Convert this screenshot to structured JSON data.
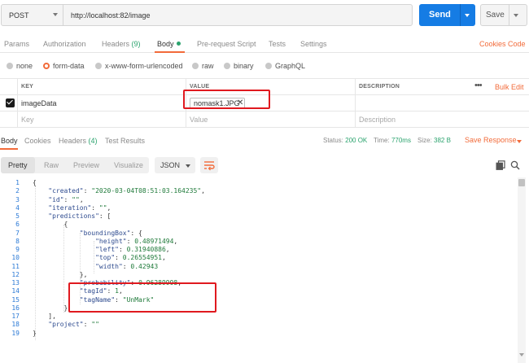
{
  "request": {
    "method": "POST",
    "url": "http://localhost:82/image",
    "send_label": "Send",
    "save_label": "Save"
  },
  "request_tabs": [
    {
      "label": "Params"
    },
    {
      "label": "Authorization"
    },
    {
      "label": "Headers",
      "count": "(9)"
    },
    {
      "label": "Body"
    },
    {
      "label": "Pre-request Script"
    },
    {
      "label": "Tests"
    },
    {
      "label": "Settings"
    }
  ],
  "request_links": {
    "cookies": "Cookies",
    "code": "Code"
  },
  "body_types": [
    {
      "label": "none",
      "selected": false
    },
    {
      "label": "form-data",
      "selected": true
    },
    {
      "label": "x-www-form-urlencoded",
      "selected": false
    },
    {
      "label": "raw",
      "selected": false
    },
    {
      "label": "binary",
      "selected": false
    },
    {
      "label": "GraphQL",
      "selected": false
    }
  ],
  "params_table": {
    "headers": {
      "key": "KEY",
      "value": "VALUE",
      "description": "DESCRIPTION"
    },
    "bulk_edit": "Bulk Edit",
    "rows": [
      {
        "checked": true,
        "key": "imageData",
        "value_file": "nomask1.JPG"
      }
    ],
    "placeholders": {
      "key": "Key",
      "value": "Value",
      "description": "Description"
    }
  },
  "response_tabs": [
    {
      "label": "Body"
    },
    {
      "label": "Cookies"
    },
    {
      "label": "Headers",
      "count": "(4)"
    },
    {
      "label": "Test Results"
    }
  ],
  "response_stats": {
    "status_label": "Status:",
    "status_value": "200 OK",
    "time_label": "Time:",
    "time_value": "770ms",
    "size_label": "Size:",
    "size_value": "382 B",
    "save_response": "Save Response"
  },
  "view_modes": [
    "Pretty",
    "Raw",
    "Preview",
    "Visualize"
  ],
  "format": "JSON",
  "accent_color": "#f26b3a",
  "send_color": "#157ce4",
  "highlight_color": "#e0191f",
  "code_lines": [
    "{",
    "    \"created\": \"2020-03-04T08:51:03.164235\",",
    "    \"id\": \"\",",
    "    \"iteration\": \"\",",
    "    \"predictions\": [",
    "        {",
    "            \"boundingBox\": {",
    "                \"height\": 0.48971494,",
    "                \"left\": 0.31940886,",
    "                \"top\": 0.26554951,",
    "                \"width\": 0.42943",
    "            },",
    "            \"probability\": 0.96289998,",
    "            \"tagId\": 1,",
    "            \"tagName\": \"UnMark\"",
    "        }",
    "    ],",
    "    \"project\": \"\"",
    "}"
  ]
}
